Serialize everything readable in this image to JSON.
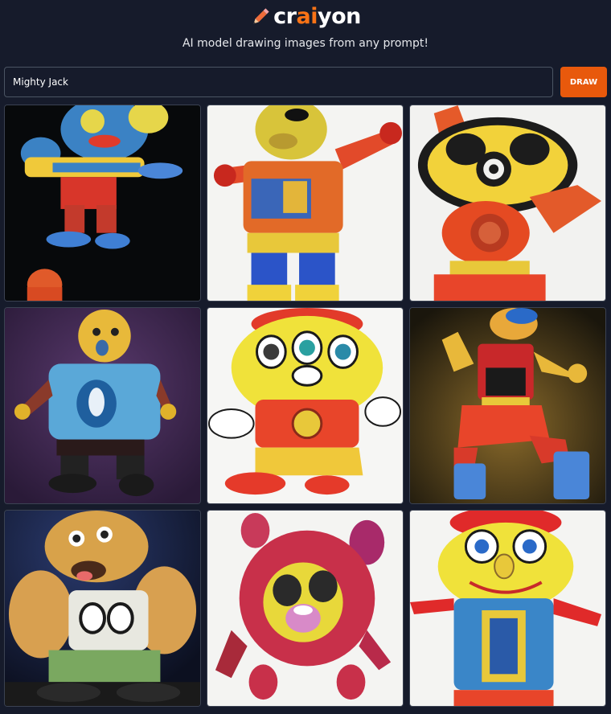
{
  "header": {
    "logo_prefix": "cr",
    "logo_accent": "ai",
    "logo_suffix": "yon",
    "tagline": "AI model drawing images from any prompt!",
    "logo_icon": "pencil-icon"
  },
  "prompt": {
    "value": "Mighty Jack",
    "draw_label": "DRAW"
  },
  "colors": {
    "background": "#161b2b",
    "accent": "#e8590c",
    "logo_accent": "#f97316"
  },
  "results": {
    "count": 9
  }
}
